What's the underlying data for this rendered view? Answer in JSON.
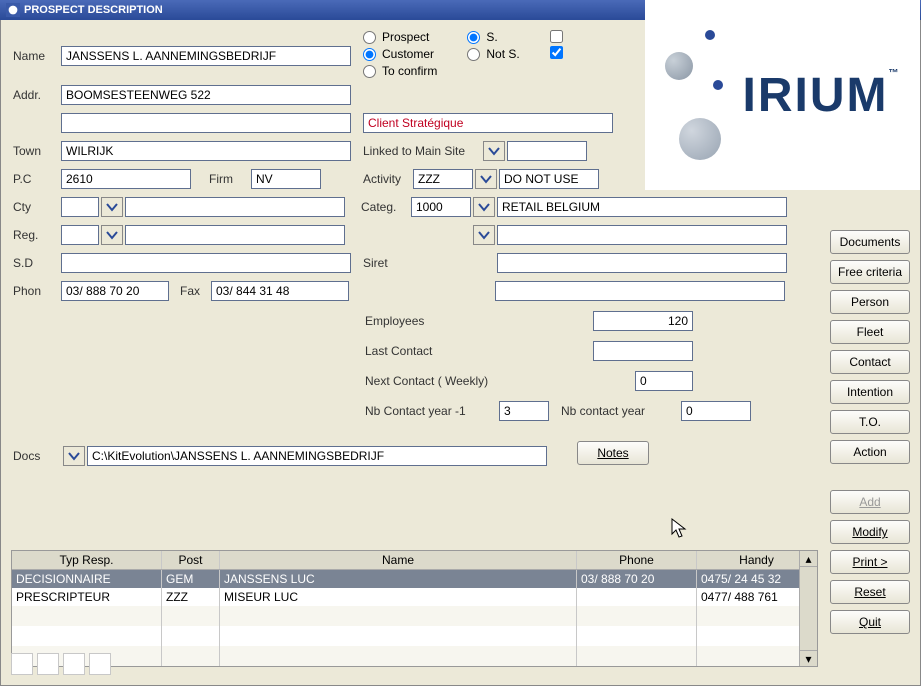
{
  "window": {
    "title": "PROSPECT DESCRIPTION"
  },
  "labels": {
    "name": "Name",
    "addr": "Addr.",
    "town": "Town",
    "pc": "P.C",
    "firm": "Firm",
    "cty": "Cty",
    "reg": "Reg.",
    "sd": "S.D",
    "phon": "Phon",
    "fax": "Fax",
    "linked": "Linked to Main Site",
    "activity": "Activity",
    "categ": "Categ.",
    "siret": "Siret",
    "employees": "Employees",
    "lastcontact": "Last Contact",
    "nextcontact": "Next Contact ( Weekly)",
    "nbyear_1": "Nb Contact year -1",
    "nbyear": "Nb contact year",
    "docs": "Docs"
  },
  "radios": {
    "prospect": "Prospect",
    "customer": "Customer",
    "toconfirm": "To confirm",
    "s": "S.",
    "nots": "Not  S."
  },
  "fields": {
    "name": "JANSSENS L. AANNEMINGSBEDRIJF",
    "addr1": "BOOMSESTEENWEG 522",
    "addr2": "",
    "status_text": "Client Stratégique",
    "town": "WILRIJK",
    "pc": "2610",
    "firm": "NV",
    "linked": "",
    "activity": "ZZZ",
    "activity_desc": "DO NOT USE",
    "cty": "",
    "categ": "1000",
    "categ_desc": "RETAIL BELGIUM",
    "reg": "",
    "reg_lookup_right": "",
    "sd": "",
    "siret": "",
    "siret2": "",
    "phon": "03/ 888 70 20",
    "fax": "03/ 844 31 48",
    "employees": "120",
    "lastcontact": "",
    "nextcontact": "0",
    "nbyear_1": "3",
    "nbyear": "0",
    "docs": "C:\\KitEvolution\\JANSSENS L. AANNEMINGSBEDRIJF"
  },
  "buttons": {
    "notes": "Notes",
    "side": [
      "Documents",
      "Free criteria",
      "Person",
      "Fleet",
      "Contact",
      "Intention",
      "T.O.",
      "Action"
    ],
    "bottom": [
      "Add",
      "Modify",
      "Print >",
      "Reset",
      "Quit"
    ]
  },
  "grid": {
    "headers": {
      "typ": "Typ Resp.",
      "post": "Post",
      "name": "Name",
      "phone": "Phone",
      "handy": "Handy"
    },
    "rows": [
      {
        "typ": "DECISIONNAIRE",
        "post": "GEM",
        "name": "JANSSENS LUC",
        "phone": "03/ 888 70 20",
        "handy": "0475/ 24 45 32"
      },
      {
        "typ": "PRESCRIPTEUR",
        "post": "ZZZ",
        "name": "MISEUR LUC",
        "phone": "",
        "handy": "0477/ 488 761"
      }
    ]
  },
  "logo": {
    "text": "IRIUM",
    "tm": "™"
  }
}
